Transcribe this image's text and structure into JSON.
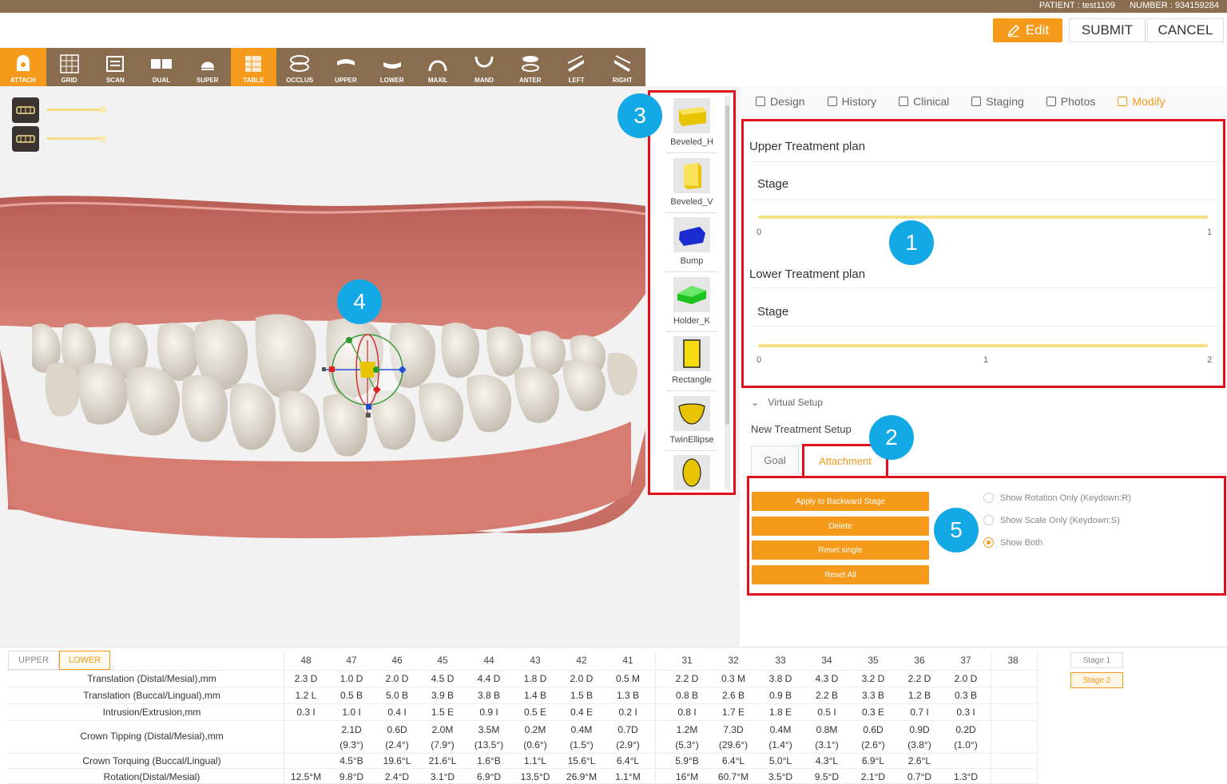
{
  "header": {
    "patient": "PATIENT : test1109",
    "number": "NUMBER : 934159284"
  },
  "actions": {
    "edit": "Edit",
    "submit": "SUBMIT",
    "cancel": "CANCEL"
  },
  "toolbar": [
    {
      "label": "ATTACH",
      "icon": "attach-icon",
      "active": true
    },
    {
      "label": "GRID",
      "icon": "grid-icon"
    },
    {
      "label": "SCAN",
      "icon": "scan-icon"
    },
    {
      "label": "DUAL",
      "icon": "dual-icon"
    },
    {
      "label": "SUPER",
      "icon": "super-icon"
    },
    {
      "label": "TABLE",
      "icon": "table-icon",
      "active": true
    },
    {
      "label": "OCCLUS",
      "icon": "occlus-icon"
    },
    {
      "label": "UPPER",
      "icon": "upper-icon"
    },
    {
      "label": "LOWER",
      "icon": "lower-icon"
    },
    {
      "label": "MAXIL",
      "icon": "maxil-icon"
    },
    {
      "label": "MAND",
      "icon": "mand-icon"
    },
    {
      "label": "ANTER",
      "icon": "anter-icon"
    },
    {
      "label": "LEFT",
      "icon": "left-icon"
    },
    {
      "label": "RIGHT",
      "icon": "right-icon"
    }
  ],
  "shapes": [
    {
      "label": "Beveled_H",
      "icon": "beveled-h-icon",
      "color": "#e8c400"
    },
    {
      "label": "Beveled_V",
      "icon": "beveled-v-icon",
      "color": "#e8c400"
    },
    {
      "label": "Bump",
      "icon": "bump-icon",
      "color": "#1a2bd0"
    },
    {
      "label": "Holder_K",
      "icon": "holder-k-icon",
      "color": "#1ec21e"
    },
    {
      "label": "Rectangle",
      "icon": "rectangle-icon",
      "color": "#f5dc10"
    },
    {
      "label": "TwinEllipse",
      "icon": "twinellipse-icon",
      "color": "#e8c400"
    },
    {
      "label": "",
      "icon": "ellipse-icon",
      "color": "#e8c400"
    }
  ],
  "callouts": {
    "c1": "1",
    "c2": "2",
    "c3": "3",
    "c4": "4",
    "c5": "5"
  },
  "tabs": [
    {
      "label": "Design",
      "icon": "design-icon"
    },
    {
      "label": "History",
      "icon": "history-icon"
    },
    {
      "label": "Clinical",
      "icon": "clinical-icon"
    },
    {
      "label": "Staging",
      "icon": "staging-icon"
    },
    {
      "label": "Photos",
      "icon": "photos-icon"
    },
    {
      "label": "Modify",
      "icon": "modify-icon",
      "active": true
    }
  ],
  "plans": {
    "upper_title": "Upper Treatment plan",
    "upper_stage": "Stage",
    "upper_ticks": [
      "0",
      "1"
    ],
    "lower_title": "Lower Treatment plan",
    "lower_stage": "Stage",
    "lower_ticks": [
      "0",
      "1",
      "2"
    ]
  },
  "virtual_setup": "Virtual Setup",
  "new_setup": "New Treatment Setup",
  "subtabs": {
    "goal": "Goal",
    "attachment": "Attachment"
  },
  "buttons": {
    "apply": "Apply to Backward Stage",
    "delete": "Delete",
    "reset_single": "Reset single",
    "reset_all": "Reset All"
  },
  "radios": [
    {
      "label": "Show Rotation Only (Keydown:R)",
      "checked": false
    },
    {
      "label": "Show Scale Only (Keydown:S)",
      "checked": false
    },
    {
      "label": "Show Both",
      "checked": true
    }
  ],
  "table": {
    "arch_tabs": [
      "UPPER",
      "LOWER"
    ],
    "columns": [
      "48",
      "47",
      "46",
      "45",
      "44",
      "43",
      "42",
      "41",
      "31",
      "32",
      "33",
      "34",
      "35",
      "36",
      "37",
      "38"
    ],
    "rows": [
      {
        "label": "Translation (Distal/Mesial),mm",
        "values": [
          "2.3 D",
          "1.0 D",
          "2.0 D",
          "4.5 D",
          "4.4 D",
          "1.8 D",
          "2.0 D",
          "0.5 M",
          "2.2 D",
          "0.3 M",
          "3.8 D",
          "4.3 D",
          "3.2 D",
          "2.2 D",
          "2.0 D",
          ""
        ]
      },
      {
        "label": "Translation (Buccal/Lingual),mm",
        "values": [
          "1.2 L",
          "0.5 B",
          "5.0 B",
          "3.9 B",
          "3.8 B",
          "1.4 B",
          "1.5 B",
          "1.3 B",
          "0.8 B",
          "2.6 B",
          "0.9 B",
          "2.2 B",
          "3.3 B",
          "1.2 B",
          "0.3 B",
          ""
        ]
      },
      {
        "label": "Intrusion/Extrusion,mm",
        "values": [
          "0.3 I",
          "1.0 I",
          "0.4 I",
          "1.5 E",
          "0.9 I",
          "0.5 E",
          "0.4 E",
          "0.2 I",
          "0.8 I",
          "1.7 E",
          "1.8 E",
          "0.5 I",
          "0.3 E",
          "0.7 I",
          "0.3 I",
          ""
        ]
      },
      {
        "label": "Crown Tipping (Distal/Mesial),mm",
        "values": [
          "",
          "2.1D",
          "0.6D",
          "2.0M",
          "3.5M",
          "0.2M",
          "0.4M",
          "0.7D",
          "1.2M",
          "7.3D",
          "0.4M",
          "0.8M",
          "0.6D",
          "0.9D",
          "0.2D",
          ""
        ],
        "sub": [
          "",
          "(9.3°)",
          "(2.4°)",
          "(7.9°)",
          "(13.5°)",
          "(0.6°)",
          "(1.5°)",
          "(2.9°)",
          "(5.3°)",
          "(29.6°)",
          "(1.4°)",
          "(3.1°)",
          "(2.6°)",
          "(3.8°)",
          "(1.0°)",
          ""
        ]
      },
      {
        "label": "Crown Torquing (Buccal/Lingual)",
        "values": [
          "",
          "4.5°B",
          "19.6°L",
          "21.6°L",
          "1.6°B",
          "1.1°L",
          "15.6°L",
          "6.4°L",
          "5.9°B",
          "6.4°L",
          "5.0°L",
          "4.3°L",
          "6.9°L",
          "2.6°L",
          "",
          ""
        ]
      },
      {
        "label": "Rotation(Distal/Mesial)",
        "values": [
          "12.5°M",
          "9.8°D",
          "2.4°D",
          "3.1°D",
          "6.9°D",
          "13.5°D",
          "26.9°M",
          "1.1°M",
          "16°M",
          "60.7°M",
          "3.5°D",
          "9.5°D",
          "2.1°D",
          "0.7°D",
          "1.3°D",
          ""
        ]
      }
    ],
    "stages": [
      "Stage 1",
      "Stage 2"
    ]
  },
  "colors": {
    "accent": "#f59a1a",
    "brand_bar": "#8a6d4f",
    "highlight": "#e0101c",
    "callout": "#13a8e6",
    "gum": "#cf7468",
    "tooth": "#e8e2d8"
  }
}
